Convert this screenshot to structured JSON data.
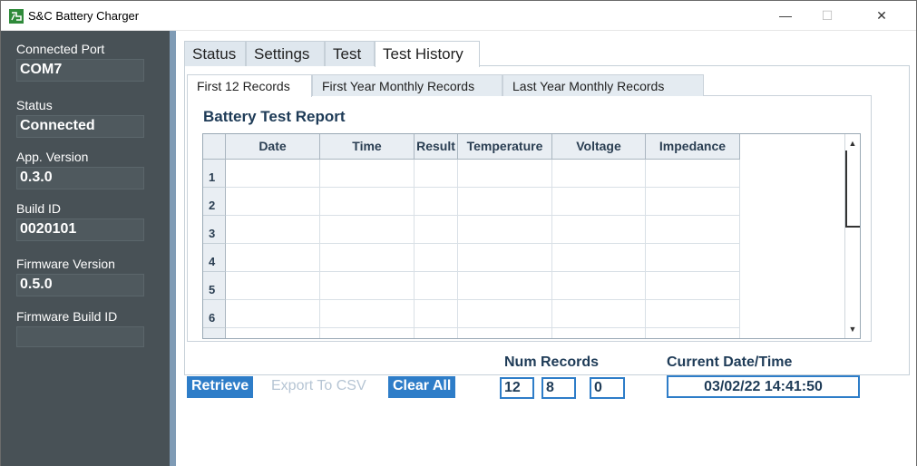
{
  "window": {
    "title": "S&C Battery Charger",
    "controls": {
      "minimize": "—",
      "maximize": "☐",
      "close": "✕"
    }
  },
  "sidebar": {
    "connected_port_label": "Connected Port",
    "connected_port_value": "COM7",
    "status_label": "Status",
    "status_value": "Connected",
    "app_version_label": "App. Version",
    "app_version_value": "0.3.0",
    "build_id_label": "Build ID",
    "build_id_value": "0020101",
    "firmware_version_label": "Firmware Version",
    "firmware_version_value": "0.5.0",
    "firmware_build_id_label": "Firmware Build ID",
    "firmware_build_id_value": ""
  },
  "tabs": [
    {
      "label": "Status",
      "active": false
    },
    {
      "label": "Settings",
      "active": false
    },
    {
      "label": "Test",
      "active": false
    },
    {
      "label": "Test History",
      "active": true
    }
  ],
  "subtabs": [
    {
      "label": "First 12 Records",
      "active": true
    },
    {
      "label": "First Year Monthly Records",
      "active": false
    },
    {
      "label": "Last Year Monthly Records",
      "active": false
    }
  ],
  "report": {
    "title": "Battery Test Report",
    "columns": [
      "Date",
      "Time",
      "Result",
      "Temperature",
      "Voltage",
      "Impedance"
    ],
    "row_numbers": [
      "1",
      "2",
      "3",
      "4",
      "5",
      "6"
    ]
  },
  "actions": {
    "retrieve": "Retrieve",
    "export_csv": "Export To CSV",
    "clear_all": "Clear All"
  },
  "num_records": {
    "label": "Num Records",
    "values": [
      "12",
      "8",
      "0"
    ]
  },
  "current_datetime": {
    "label": "Current Date/Time",
    "value": "03/02/22 14:41:50"
  },
  "colors": {
    "sidebar_bg": "#485156",
    "accent_blue": "#2e7dc8",
    "text_dark": "#1e3b57"
  }
}
